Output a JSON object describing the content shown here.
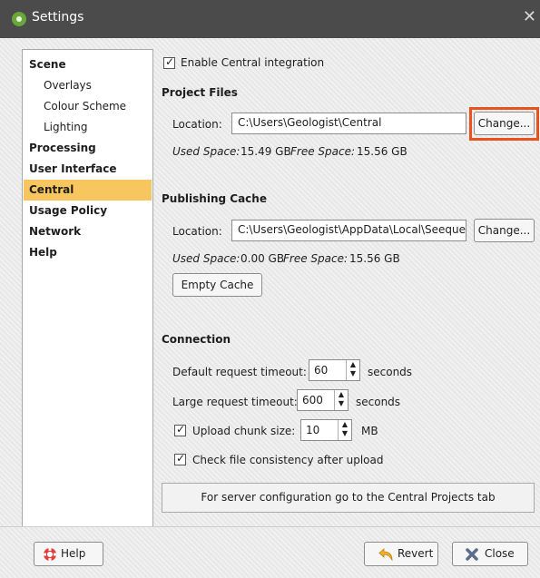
{
  "window": {
    "title": "Settings",
    "close_glyph": "✕"
  },
  "nav": {
    "items": [
      {
        "label": "Scene"
      },
      {
        "label": "Overlays"
      },
      {
        "label": "Colour Scheme"
      },
      {
        "label": "Lighting"
      },
      {
        "label": "Processing"
      },
      {
        "label": "User Interface"
      },
      {
        "label": "Central",
        "selected": true
      },
      {
        "label": "Usage Policy"
      },
      {
        "label": "Network"
      },
      {
        "label": "Help"
      }
    ]
  },
  "central": {
    "enable_label": "Enable Central integration",
    "enable_checked": true,
    "project_files": {
      "heading": "Project Files",
      "location_label": "Location:",
      "location_value": "C:\\Users\\Geologist\\Central",
      "change_label": "Change...",
      "used_label": "Used Space:",
      "used_value": "15.49 GB",
      "free_label": "Free Space:",
      "free_value": "15.56 GB"
    },
    "publishing_cache": {
      "heading": "Publishing Cache",
      "location_label": "Location:",
      "location_value": "C:\\Users\\Geologist\\AppData\\Local\\Seequent",
      "change_label": "Change...",
      "used_label": "Used Space:",
      "used_value": "0.00 GB",
      "free_label": "Free Space:",
      "free_value": "15.56 GB",
      "empty_label": "Empty Cache"
    },
    "connection": {
      "heading": "Connection",
      "default_timeout_label": "Default request timeout:",
      "default_timeout_value": "60",
      "default_timeout_unit": "seconds",
      "large_timeout_label": "Large request timeout:",
      "large_timeout_value": "600",
      "large_timeout_unit": "seconds",
      "chunk_label": "Upload chunk size:",
      "chunk_value": "10",
      "chunk_unit": "MB",
      "chunk_checked": true,
      "consistency_label": "Check file consistency after upload",
      "consistency_checked": true
    },
    "server_note": "For server configuration go to the Central Projects tab"
  },
  "footer": {
    "help_label": "Help",
    "revert_label": "Revert",
    "close_label": "Close"
  },
  "colors": {
    "selection": "#f7c65e",
    "highlight": "#e8521d",
    "titlebar": "#4b4b4b"
  }
}
